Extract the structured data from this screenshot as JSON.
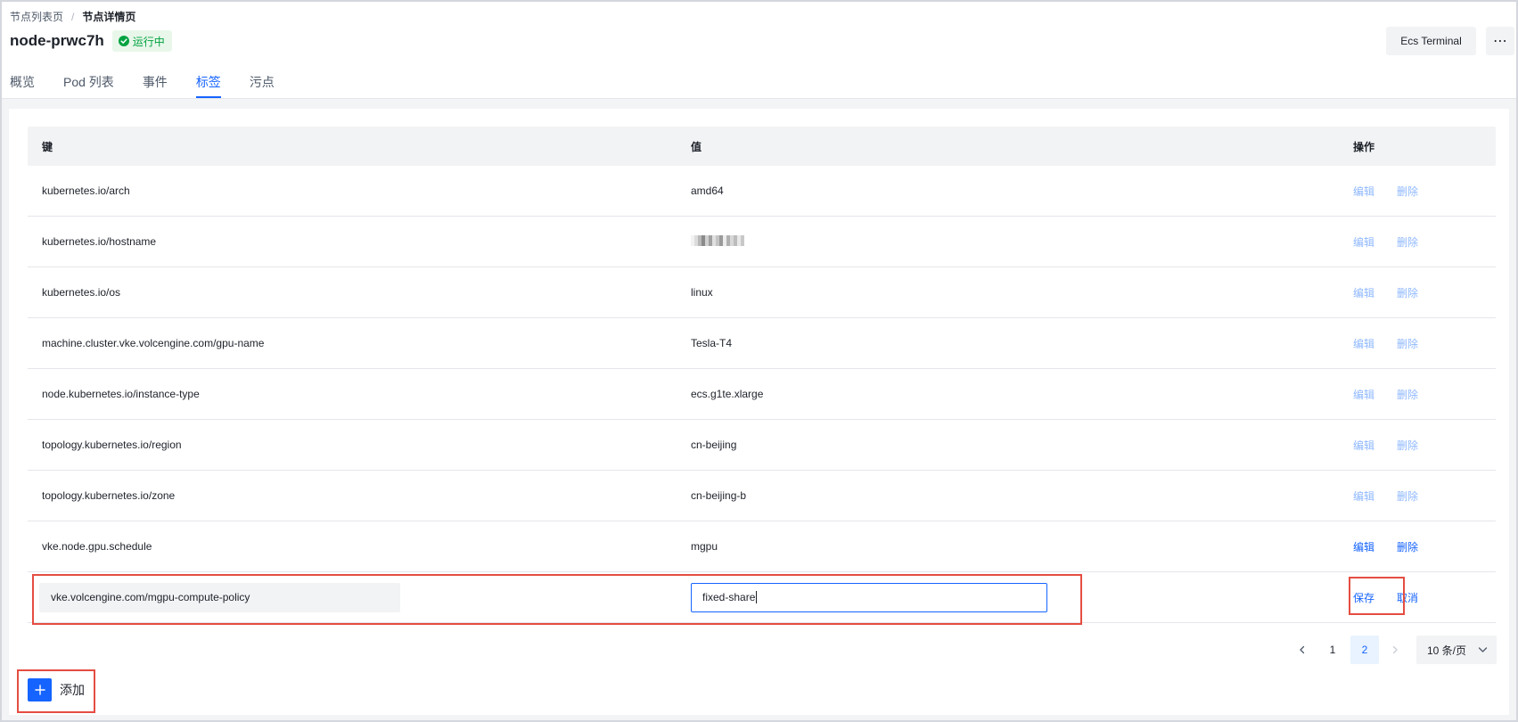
{
  "breadcrumb": {
    "parent": "节点列表页",
    "separator": "/",
    "current": "节点详情页"
  },
  "header": {
    "title": "node-prwc7h",
    "status": "运行中",
    "terminal_button": "Ecs Terminal",
    "more_button": "⋯"
  },
  "tabs": [
    {
      "label": "概览",
      "active": false
    },
    {
      "label": "Pod 列表",
      "active": false
    },
    {
      "label": "事件",
      "active": false
    },
    {
      "label": "标签",
      "active": true
    },
    {
      "label": "污点",
      "active": false
    }
  ],
  "table": {
    "columns": {
      "key": "键",
      "value": "值",
      "actions": "操作"
    },
    "rows": [
      {
        "key": "kubernetes.io/arch",
        "value": "amd64",
        "edit": "编辑",
        "delete": "删除",
        "enabled": false
      },
      {
        "key": "kubernetes.io/hostname",
        "value": "",
        "edit": "编辑",
        "delete": "删除",
        "enabled": false
      },
      {
        "key": "kubernetes.io/os",
        "value": "linux",
        "edit": "编辑",
        "delete": "删除",
        "enabled": false
      },
      {
        "key": "machine.cluster.vke.volcengine.com/gpu-name",
        "value": "Tesla-T4",
        "edit": "编辑",
        "delete": "删除",
        "enabled": false
      },
      {
        "key": "node.kubernetes.io/instance-type",
        "value": "ecs.g1te.xlarge",
        "edit": "编辑",
        "delete": "删除",
        "enabled": false
      },
      {
        "key": "topology.kubernetes.io/region",
        "value": "cn-beijing",
        "edit": "编辑",
        "delete": "删除",
        "enabled": false
      },
      {
        "key": "topology.kubernetes.io/zone",
        "value": "cn-beijing-b",
        "edit": "编辑",
        "delete": "删除",
        "enabled": false
      },
      {
        "key": "vke.node.gpu.schedule",
        "value": "mgpu",
        "edit": "编辑",
        "delete": "删除",
        "enabled": true
      }
    ],
    "editing_row": {
      "key": "vke.volcengine.com/mgpu-compute-policy",
      "value": "fixed-share",
      "save": "保存",
      "cancel": "取消"
    }
  },
  "pagination": {
    "pages": [
      "1",
      "2"
    ],
    "current_page": "2",
    "page_size": "10 条/页"
  },
  "add_button": {
    "label": "添加"
  },
  "colors": {
    "accent": "#1664ff",
    "status_green": "#00a240",
    "highlight": "#e54d42",
    "link_disabled": "#8fb8ff"
  }
}
